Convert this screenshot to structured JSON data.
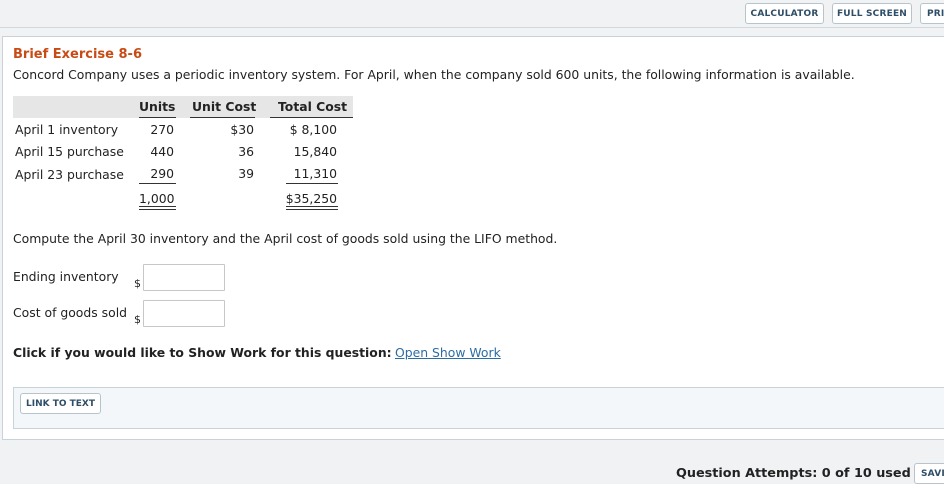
{
  "toolbar": {
    "calculator": "CALCULATOR",
    "full_screen": "FULL SCREEN",
    "print": "PRI"
  },
  "exercise": {
    "title": "Brief Exercise 8-6",
    "intro": "Concord Company uses a periodic inventory system. For April, when the company sold 600 units, the following information is available."
  },
  "table": {
    "headers": [
      "Units",
      "Unit Cost",
      "Total Cost"
    ],
    "rows": [
      {
        "label": "April 1 inventory",
        "units": "270",
        "unit_cost": "$30",
        "total": "$ 8,100"
      },
      {
        "label": "April 15 purchase",
        "units": "440",
        "unit_cost": "36",
        "total": "15,840"
      },
      {
        "label": "April 23 purchase",
        "units": "290",
        "unit_cost": "39",
        "total": "11,310"
      }
    ],
    "totals": {
      "units": "1,000",
      "total": "$35,250"
    }
  },
  "question": {
    "prompt": "Compute the April 30 inventory and the April cost of goods sold using the LIFO method.",
    "fields": [
      {
        "label": "Ending inventory",
        "currency": "$",
        "value": ""
      },
      {
        "label": "Cost of goods sold",
        "currency": "$",
        "value": ""
      }
    ]
  },
  "show_work": {
    "prompt": "Click if you would like to Show Work for this question:",
    "link": "Open Show Work"
  },
  "link_to_text": "LINK TO TEXT",
  "footer": {
    "attempts": "Question Attempts: 0 of 10 used",
    "save": "SAVI"
  }
}
